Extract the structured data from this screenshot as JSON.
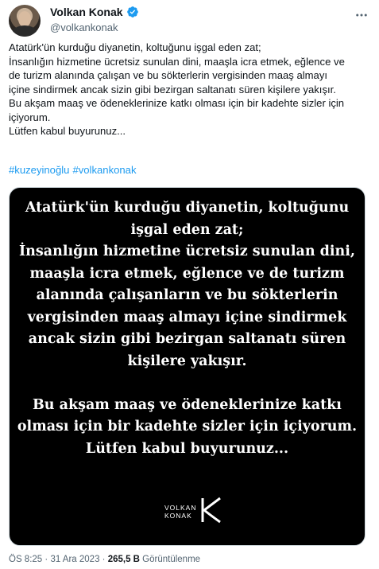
{
  "author": {
    "display_name": "Volkan Konak",
    "handle": "@volkankonak",
    "verified": true
  },
  "tweet": {
    "text": "Atatürk'ün kurduğu diyanetin, koltuğunu işgal eden zat;\nİnsanlığın hizmetine ücretsiz sunulan dini, maaşla icra etmek, eğlence ve\nde turizm alanında çalışan ve bu sökterlerin vergisinden maaş almayı\niçine sindirmek ancak sizin gibi bezirgan saltanatı süren kişilere yakışır.\nBu akşam maaş ve ödeneklerinize katkı olması için bir kadehte sizler için\niçiyorum.\nLütfen kabul buyurunuz...",
    "hashtags": [
      "#kuzeyinoğlu",
      "#volkankonak"
    ]
  },
  "media": {
    "text": "Atatürk'ün kurduğu diyanetin, koltuğunu\nişgal eden zat;\nİnsanlığın hizmetine ücretsiz sunulan dini,\nmaaşla icra etmek, eğlence ve de turizm\nalanında çalışanların ve bu sökterlerin\nvergisinden maaş almayı içine sindirmek\nancak sizin gibi bezirgan saltanatı süren\nkişilere yakışır.\n\nBu akşam maaş ve ödeneklerinize katkı\nolması için bir kadehte sizler için içiyorum.\nLütfen kabul buyurunuz...",
    "logo_line1": "VOLKAN",
    "logo_line2": "KONAK"
  },
  "meta": {
    "time": "ÖS 8:25",
    "sep": " · ",
    "date": "31 Ara 2023",
    "views_count": "265,5 B",
    "views_label": " Görüntülenme"
  },
  "icons": {
    "verified": "verified-badge-icon",
    "more": "more-options-icon",
    "logo": "volkan-konak-logo"
  },
  "colors": {
    "link": "#1d9bf0",
    "secondary_text": "#536471",
    "media_bg": "#000000"
  }
}
